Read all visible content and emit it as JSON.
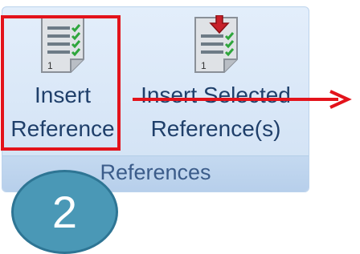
{
  "ribbon": {
    "group_label": "References",
    "buttons": [
      {
        "line1": "Insert",
        "line2": "Reference",
        "icon": "document-reference-icon"
      },
      {
        "line1": "Insert Selected",
        "line2": "Reference(s)",
        "icon": "document-insert-arrow-icon"
      }
    ]
  },
  "annotations": {
    "step_number": "2",
    "highlight_color": "#e3131b",
    "badge_color": "#4a98b6"
  }
}
